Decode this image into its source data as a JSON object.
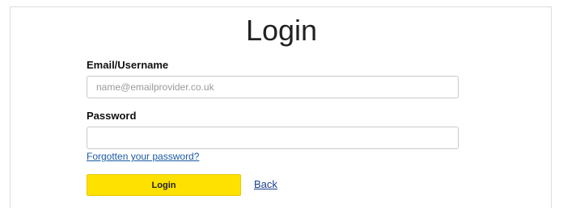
{
  "login_form": {
    "title": "Login",
    "email": {
      "label": "Email/Username",
      "value": "",
      "placeholder": "name@emailprovider.co.uk"
    },
    "password": {
      "label": "Password",
      "value": "",
      "placeholder": ""
    },
    "forgot_password_link": "Forgotten your password?",
    "submit_label": "Login",
    "back_link": "Back"
  },
  "colors": {
    "login_button": "#ffe100",
    "link": "#1a5aa6"
  }
}
